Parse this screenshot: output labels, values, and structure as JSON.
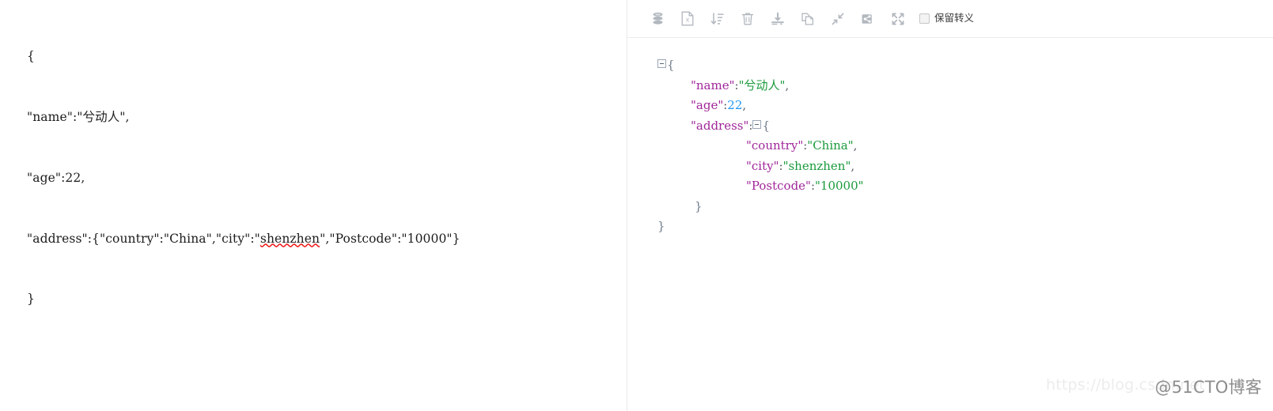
{
  "left_panel": {
    "name": "raw-json-input",
    "lines": [
      "{",
      "\"name\":\"兮动人\",",
      "\"age\":22,",
      "\"address\":{\"country\":\"China\",\"city\":\"",
      "\"}"
    ],
    "line_4_prefix": "\"address\":{\"country\":\"China\",\"city\":\"",
    "line_4_misspelled": "shenzhen",
    "line_4_suffix": "\",\"Postcode\":\"10000\"}",
    "closing_brace": "}"
  },
  "toolbar": {
    "buttons": [
      {
        "name": "database-icon",
        "title": "database"
      },
      {
        "name": "excel-file-icon",
        "title": "excel"
      },
      {
        "name": "sort-ascending-icon",
        "title": "sort"
      },
      {
        "name": "trash-icon",
        "title": "delete"
      },
      {
        "name": "download-icon",
        "title": "download"
      },
      {
        "name": "copy-icon",
        "title": "copy"
      },
      {
        "name": "collapse-arrows-icon",
        "title": "collapse"
      },
      {
        "name": "share-icon",
        "title": "share"
      },
      {
        "name": "expand-arrows-icon",
        "title": "expand"
      }
    ],
    "checkbox_label": "保留转义",
    "checkbox_checked": false
  },
  "tree": {
    "root_open_brace": "{",
    "nodes": [
      {
        "indent": 2,
        "key": "\"name\"",
        "colon": ":",
        "value": "\"兮动人\"",
        "value_type": "string",
        "trail": ","
      },
      {
        "indent": 2,
        "key": "\"age\"",
        "colon": ":",
        "value": "22",
        "value_type": "number",
        "trail": ","
      },
      {
        "indent": 2,
        "key": "\"address\"",
        "colon": ":",
        "value": "{",
        "value_type": "object",
        "trail": "",
        "collapsible": true
      },
      {
        "indent": 3,
        "key": "\"country\"",
        "colon": ":",
        "value": "\"China\"",
        "value_type": "string",
        "trail": ","
      },
      {
        "indent": 3,
        "key": "\"city\"",
        "colon": ":",
        "value": "\"shenzhen\"",
        "value_type": "string",
        "trail": ","
      },
      {
        "indent": 3,
        "key": "\"Postcode\"",
        "colon": ":",
        "value": "\"10000\"",
        "value_type": "string",
        "trail": ""
      }
    ],
    "inner_close_brace": "}",
    "root_close_brace": "}"
  },
  "watermarks": {
    "csdn": "https://blog.csdn.net",
    "cto": "@51CTO博客"
  },
  "colors": {
    "key": "#a0269a",
    "string": "#1a9a3c",
    "number": "#2196f3",
    "punct": "#555c66",
    "toolbar_icon": "#b2b8bf",
    "divider": "#e8e8e8"
  }
}
